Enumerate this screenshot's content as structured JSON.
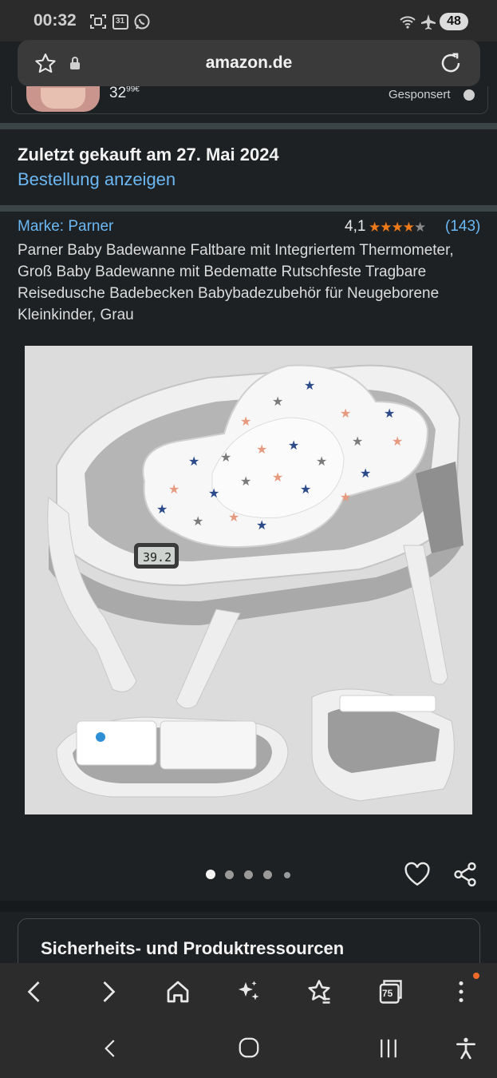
{
  "status_bar": {
    "time": "00:32",
    "icons": [
      "screenshot-icon",
      "calendar-31-icon",
      "whatsapp-icon",
      "wifi-icon",
      "airplane-icon"
    ],
    "calendar_day": "31",
    "battery": "48"
  },
  "browser": {
    "url": "amazon.de",
    "icons": [
      "star-icon",
      "lock-icon",
      "reload-icon"
    ]
  },
  "ad": {
    "price_main": "32",
    "price_cents": "99€",
    "sponsored_label": "Gesponsert"
  },
  "order": {
    "last_bought": "Zuletzt gekauft am 27. Mai 2024",
    "view_order": "Bestellung anzeigen"
  },
  "product": {
    "brand": "Marke: Parner",
    "rating": "4,1",
    "stars_value": 4.1,
    "review_count": "(143)",
    "title": "Parner Baby Badewanne Faltbare mit Integriertem Thermometer, Groß Baby Badewanne mit Bedematte Rutschfeste Tragbare Reisedusche Badebecken Babybadezubehör für Neugeborene Kleinkinder, Grau",
    "thermometer_display": "39.2",
    "image_count": 5,
    "active_image": 1
  },
  "safety_card": {
    "title": "Sicherheits- und Produktressourcen"
  },
  "browser_nav": {
    "tab_count": "75",
    "items": [
      "back-icon",
      "forward-icon",
      "home-icon",
      "ai-sparkle-icon",
      "bookmarks-icon",
      "tabs-icon",
      "menu-icon"
    ]
  },
  "system_nav": {
    "items": [
      "recents-back-icon",
      "home-circle-icon",
      "recent-apps-icon",
      "accessibility-icon"
    ]
  },
  "colors": {
    "link": "#6bb8f4",
    "star": "#ef7a1a",
    "background": "#1d2123"
  }
}
